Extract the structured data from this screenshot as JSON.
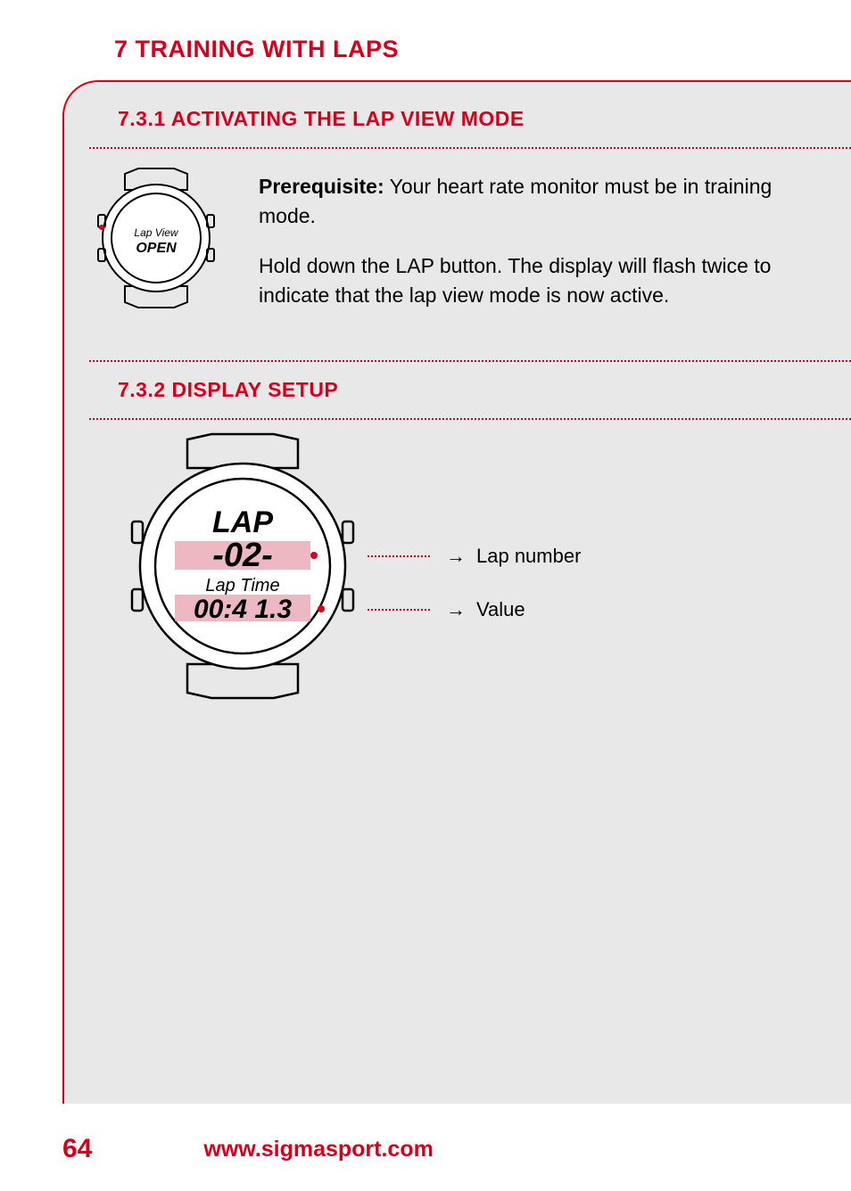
{
  "page_title": "7 TRAINING WITH LAPS",
  "section1": {
    "heading": "7.3.1 ACTIVATING THE LAP VIEW MODE",
    "prerequisite_label": "Prerequisite:",
    "prerequisite_text": " Your heart rate monitor must be in training mode.",
    "instruction": "Hold down the LAP button. The display will flash twice to indicate that the lap view mode is now active.",
    "watch_line1": "Lap View",
    "watch_line2": "OPEN"
  },
  "section2": {
    "heading": "7.3.2 DISPLAY SETUP",
    "watch_line_top": "LAP",
    "watch_line_num": "-02-",
    "watch_line_label": "Lap Time",
    "watch_line_value": "00:4 1.3",
    "annotation1": "Lap number",
    "annotation2": "Value"
  },
  "footer": {
    "page_number": "64",
    "url": "www.sigmasport.com"
  }
}
